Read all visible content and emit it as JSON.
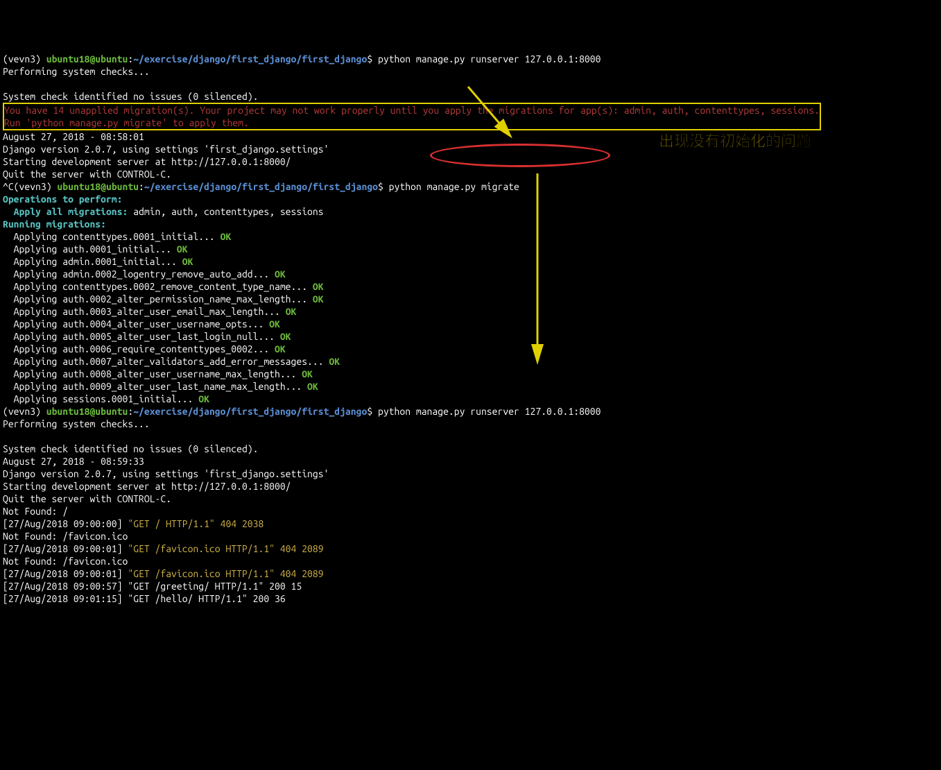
{
  "prompt1": {
    "venv": "(vevn3)",
    "user": "ubuntu18@ubuntu",
    "colon": ":",
    "path": "~/exercise/django/first_django/first_django",
    "dollar": "$",
    "cmd": " python manage.py runserver 127.0.0.1:8000"
  },
  "checks1": "Performing system checks...",
  "blank": "",
  "noissues1": "System check identified no issues (0 silenced).",
  "warning": {
    "l1": "You have 14 unapplied migration(s). Your project may not work properly until you apply the migrations for app(s): admin, auth, contenttypes, sessions.",
    "l2": "Run 'python manage.py migrate' to apply them."
  },
  "ts1": "August 27, 2018 - 08:58:01",
  "djver": "Django version 2.0.7, using settings 'first_django.settings'",
  "startdev": "Starting development server at http://127.0.0.1:8000/",
  "quit": "Quit the server with CONTROL-C.",
  "prompt2": {
    "prefix": "^C",
    "venv": "(vevn3)",
    "user": "ubuntu18@ubuntu",
    "colon": ":",
    "path": "~/exercise/django/first_django/first_django",
    "dollar": "$",
    "cmd": " python manage.py migrate"
  },
  "ops": "Operations to perform:",
  "applyall": {
    "label": "  Apply all migrations:",
    "rest": " admin, auth, contenttypes, sessions"
  },
  "running": "Running migrations:",
  "migrations": [
    {
      "t": "  Applying contenttypes.0001_initial... ",
      "ok": "OK"
    },
    {
      "t": "  Applying auth.0001_initial... ",
      "ok": "OK"
    },
    {
      "t": "  Applying admin.0001_initial... ",
      "ok": "OK"
    },
    {
      "t": "  Applying admin.0002_logentry_remove_auto_add... ",
      "ok": "OK"
    },
    {
      "t": "  Applying contenttypes.0002_remove_content_type_name... ",
      "ok": "OK"
    },
    {
      "t": "  Applying auth.0002_alter_permission_name_max_length... ",
      "ok": "OK"
    },
    {
      "t": "  Applying auth.0003_alter_user_email_max_length... ",
      "ok": "OK"
    },
    {
      "t": "  Applying auth.0004_alter_user_username_opts... ",
      "ok": "OK"
    },
    {
      "t": "  Applying auth.0005_alter_user_last_login_null... ",
      "ok": "OK"
    },
    {
      "t": "  Applying auth.0006_require_contenttypes_0002... ",
      "ok": "OK"
    },
    {
      "t": "  Applying auth.0007_alter_validators_add_error_messages... ",
      "ok": "OK"
    },
    {
      "t": "  Applying auth.0008_alter_user_username_max_length... ",
      "ok": "OK"
    },
    {
      "t": "  Applying auth.0009_alter_user_last_name_max_length... ",
      "ok": "OK"
    },
    {
      "t": "  Applying sessions.0001_initial... ",
      "ok": "OK"
    }
  ],
  "prompt3": {
    "venv": "(vevn3)",
    "user": "ubuntu18@ubuntu",
    "colon": ":",
    "path": "~/exercise/django/first_django/first_django",
    "dollar": "$",
    "cmd": " python manage.py runserver 127.0.0.1:8000"
  },
  "checks2": "Performing system checks...",
  "noissues2": "System check identified no issues (0 silenced).",
  "ts2": "August 27, 2018 - 08:59:33",
  "nf1": "Not Found: /",
  "log1": {
    "ts": "[27/Aug/2018 09:00:00] ",
    "req": "\"GET / HTTP/1.1\" 404 2038"
  },
  "nf2": "Not Found: /favicon.ico",
  "log2": {
    "ts": "[27/Aug/2018 09:00:01] ",
    "req": "\"GET /favicon.ico HTTP/1.1\" 404 2089"
  },
  "nf3": "Not Found: /favicon.ico",
  "log3": {
    "ts": "[27/Aug/2018 09:00:01] ",
    "req": "\"GET /favicon.ico HTTP/1.1\" 404 2089"
  },
  "log4": "[27/Aug/2018 09:00:57] \"GET /greeting/ HTTP/1.1\" 200 15",
  "log5": "[27/Aug/2018 09:01:15] \"GET /hello/ HTTP/1.1\" 200 36",
  "annotation": "出现没有初始化的问题"
}
